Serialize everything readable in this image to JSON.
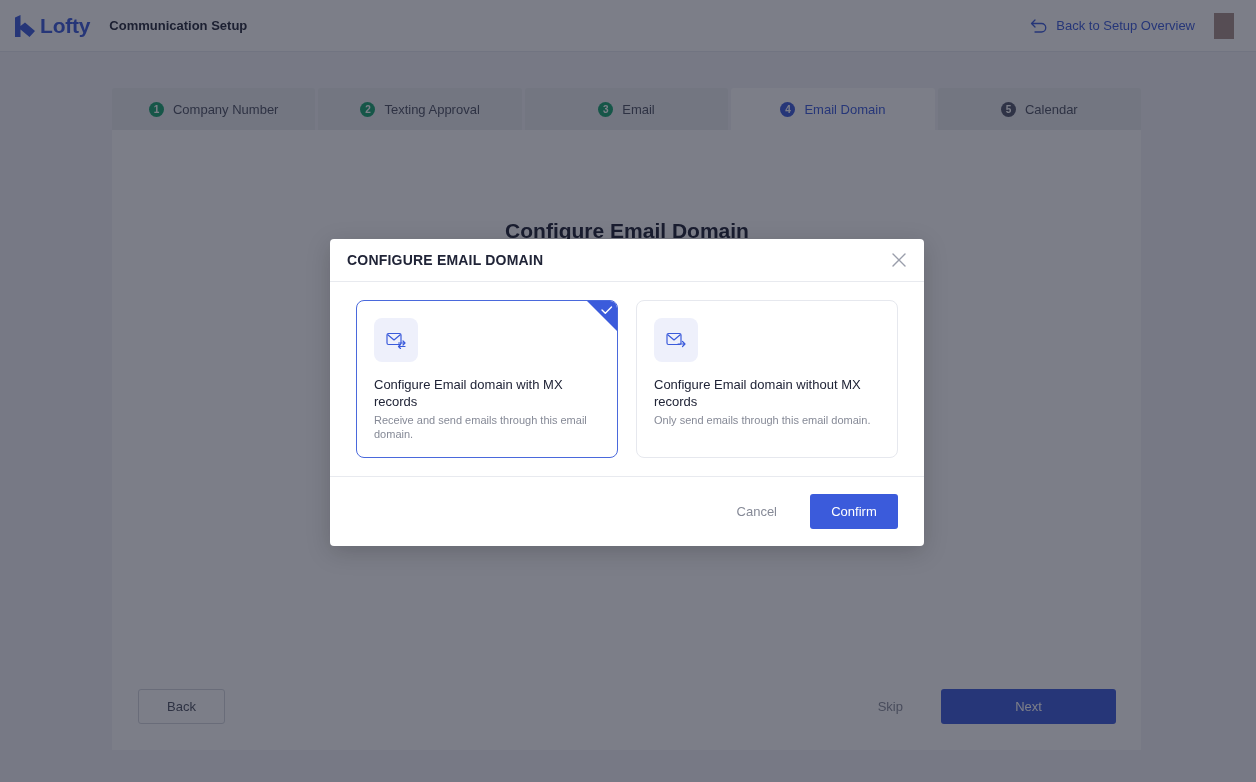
{
  "header": {
    "logo": "Lofty",
    "title": "Communication Setup",
    "back_link": "Back to Setup Overview"
  },
  "steps": [
    {
      "number": "1",
      "label": "Company Number",
      "completed": true,
      "selected": false
    },
    {
      "number": "2",
      "label": "Texting Approval",
      "completed": true,
      "selected": false
    },
    {
      "number": "3",
      "label": "Email",
      "completed": true,
      "selected": false
    },
    {
      "number": "4",
      "label": "Email Domain",
      "completed": false,
      "selected": true
    },
    {
      "number": "5",
      "label": "Calendar",
      "completed": false,
      "selected": false
    }
  ],
  "panel": {
    "heading": "Configure Email Domain",
    "buttons": {
      "back": "Back",
      "skip": "Skip",
      "next": "Next"
    }
  },
  "dialog": {
    "title": "CONFIGURE EMAIL DOMAIN",
    "options": [
      {
        "title": "Configure Email domain with MX records",
        "description": "Receive and send emails through this email domain.",
        "selected": true
      },
      {
        "title": "Configure Email domain without MX records",
        "description": "Only send emails through this email domain.",
        "selected": false
      }
    ],
    "buttons": {
      "cancel": "Cancel",
      "confirm": "Confirm"
    }
  }
}
